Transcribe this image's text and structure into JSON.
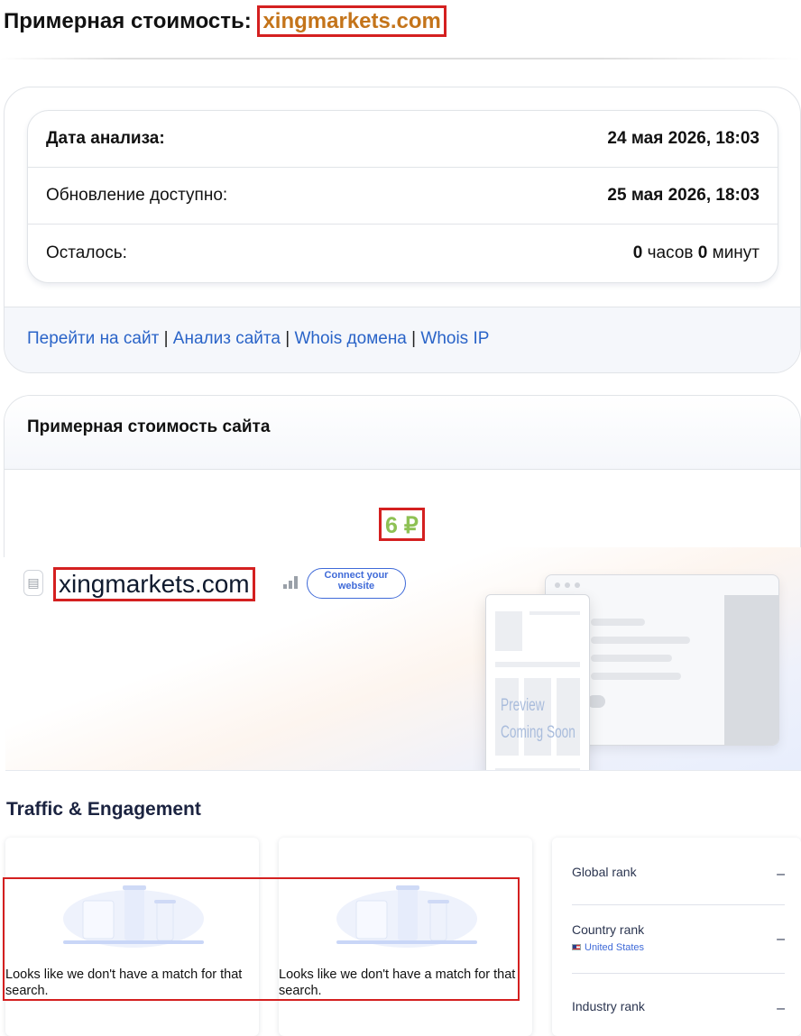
{
  "header": {
    "title_prefix": "Примерная стоимость:",
    "domain": "xingmarkets.com"
  },
  "analysis": {
    "rows": [
      {
        "label": "Дата анализа:",
        "value": "24 мая 2026, 18:03"
      },
      {
        "label": "Обновление доступно:",
        "value": "25 мая 2026, 18:03"
      }
    ],
    "remaining": {
      "label": "Осталось:",
      "hours": "0",
      "hours_unit": "часов",
      "minutes": "0",
      "minutes_unit": "минут"
    }
  },
  "links": {
    "items": [
      "Перейти на сайт",
      "Анализ сайта",
      "Whois домена",
      "Whois IP"
    ],
    "separator": "|"
  },
  "valuation": {
    "heading": "Примерная стоимость сайта",
    "price": "6 ₽"
  },
  "embed": {
    "domain": "xingmarkets.com",
    "connect_button": "Connect your website",
    "preview_text_line1": "Preview",
    "preview_text_line2": "Coming Soon",
    "section_title": "Traffic & Engagement",
    "empty_message": "Looks like we don't have a match for that search.",
    "ranks": {
      "global_label": "Global rank",
      "global_value": "–",
      "country_label": "Country rank",
      "country_name": "United States",
      "country_value": "–",
      "industry_label": "Industry rank",
      "industry_value": "–"
    }
  },
  "colors": {
    "title_domain": "#c4741a",
    "highlight_border": "#d42020",
    "price": "#8ec154",
    "link": "#2a64c8",
    "accent_blue": "#3f6ad8"
  },
  "icons": [
    "file-icon",
    "signal-bars-icon",
    "us-flag-icon",
    "empty-state-illustration"
  ]
}
